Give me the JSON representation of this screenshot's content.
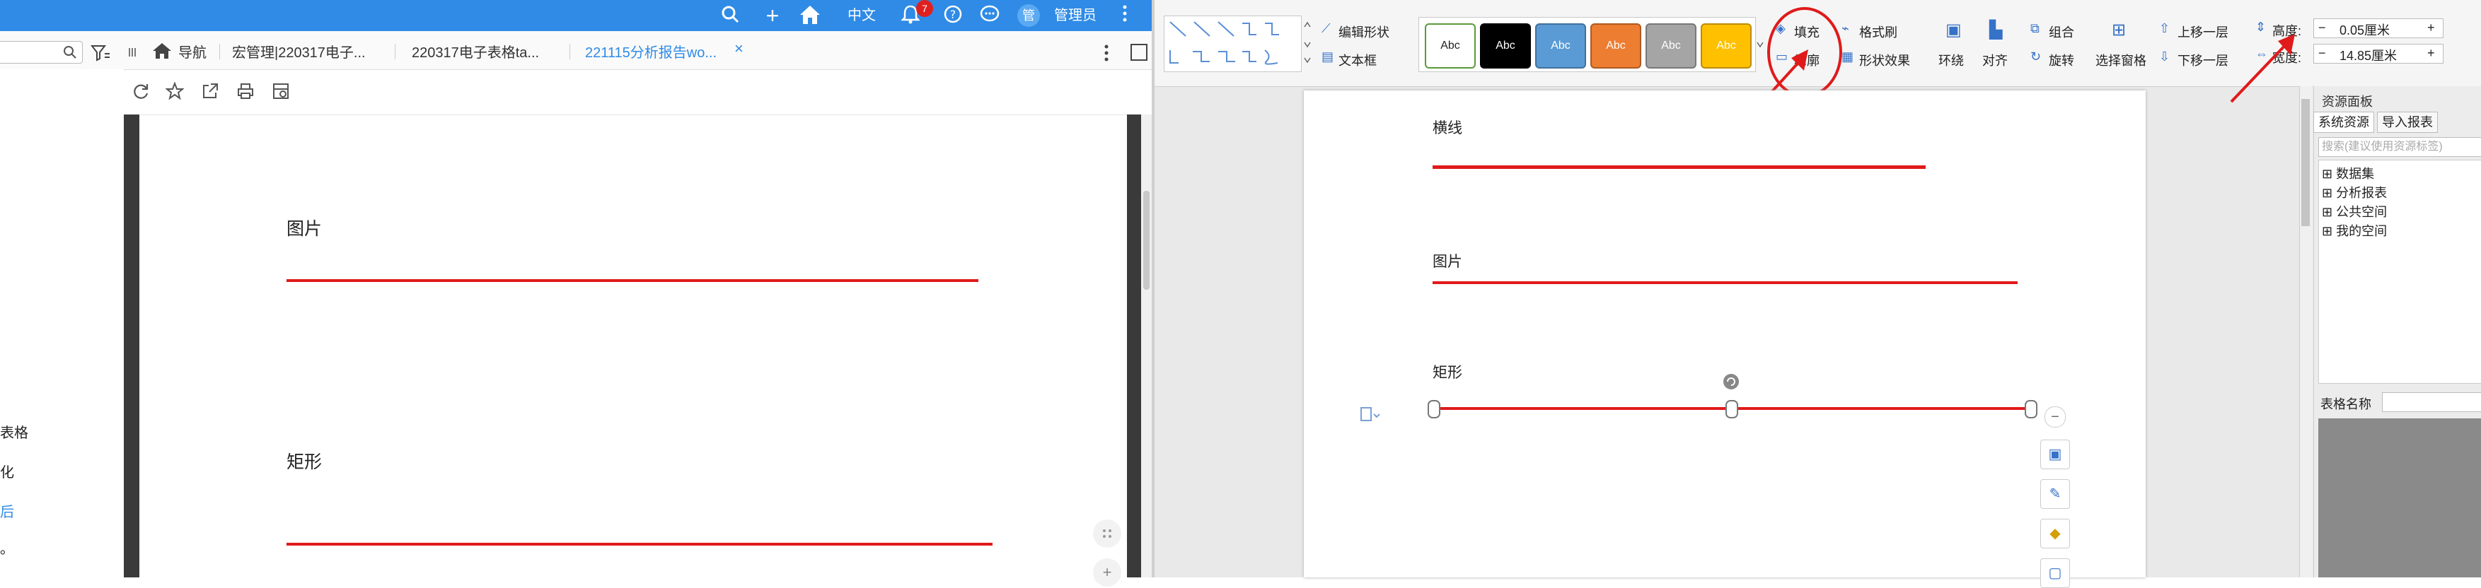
{
  "left": {
    "topbar": {
      "lang": "中文",
      "notif_count": "7",
      "avatar_char": "管",
      "user": "管理员"
    },
    "tabs": [
      {
        "label": "导航"
      },
      {
        "label": "宏管理|220317电子..."
      },
      {
        "label": "220317电子表格ta..."
      },
      {
        "label": "221115分析报告wo..."
      }
    ],
    "sidebar_items": [
      "表格",
      "化",
      "后",
      "。"
    ],
    "doc": {
      "label1": "图片",
      "label2": "矩形"
    }
  },
  "right": {
    "ribbon": {
      "edit_shape": "编辑形状",
      "text_box": "文本框",
      "style_swatches": [
        {
          "text": "Abc",
          "bg": "#ffffff",
          "fg": "#222222",
          "border": "#5a9a3a"
        },
        {
          "text": "Abc",
          "bg": "#000000",
          "fg": "#ffffff",
          "border": "#000000"
        },
        {
          "text": "Abc",
          "bg": "#5b9bd5",
          "fg": "#ffffff",
          "border": "#41719c"
        },
        {
          "text": "Abc",
          "bg": "#ed7d31",
          "fg": "#ffffff",
          "border": "#ae5a21"
        },
        {
          "text": "Abc",
          "bg": "#a5a5a5",
          "fg": "#ffffff",
          "border": "#787878"
        },
        {
          "text": "Abc",
          "bg": "#ffc000",
          "fg": "#ffffff",
          "border": "#bc8c00"
        }
      ],
      "fill": "填充",
      "outline": "轮廓",
      "format_painter": "格式刷",
      "shape_effects": "形状效果",
      "wrap": "环绕",
      "align": "对齐",
      "group": "组合",
      "rotate": "旋转",
      "selection_pane": "选择窗格",
      "bring_forward": "上移一层",
      "send_backward": "下移一层",
      "height_label": "高度:",
      "height_value": "0.05厘米",
      "width_label": "宽度:",
      "width_value": "14.85厘米"
    },
    "doc": {
      "label_hline": "横线",
      "label_image": "图片",
      "label_rect": "矩形"
    },
    "resource_panel": {
      "title": "资源面板",
      "tab_system": "系统资源",
      "tab_import": "导入报表",
      "search_placeholder": "搜索(建议使用资源标签)",
      "tree": [
        "数据集",
        "分析报表",
        "公共空间",
        "我的空间"
      ],
      "table_name_label": "表格名称"
    }
  },
  "colors": {
    "topbar": "#2f8be6",
    "accent_red": "#e01a1a",
    "active_tab": "#2f8be6"
  }
}
